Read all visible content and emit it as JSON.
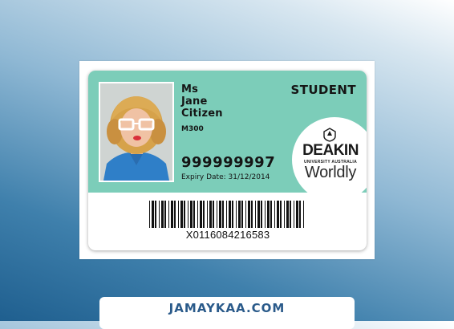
{
  "card": {
    "title_line": "Ms",
    "first_name": "Jane",
    "last_name": "Citizen",
    "code": "M300",
    "role": "STUDENT",
    "id_number": "999999997",
    "expiry": "Expiry Date: 31/12/2014",
    "barcode_value": "X0116084216583",
    "colors": {
      "panel": "#7ccdb9",
      "text": "#151515"
    }
  },
  "logo": {
    "name": "DEAKIN",
    "subtitle": "UNIVERSITY AUSTRALIA",
    "tagline": "Worldly",
    "emblem_icon": "crest-icon"
  },
  "footer": {
    "site": "JAMAYKAA.COM"
  }
}
